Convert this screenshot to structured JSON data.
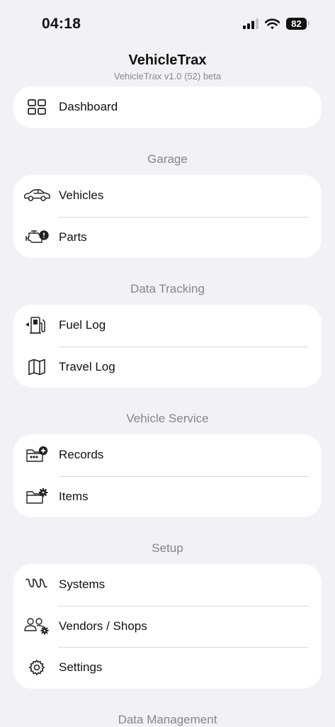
{
  "status_bar": {
    "time": "04:18",
    "battery": "82"
  },
  "header": {
    "title": "VehicleTrax",
    "version": "VehicleTrax v1.0 (52) beta"
  },
  "dashboard": {
    "label": "Dashboard",
    "icon": "grid-icon"
  },
  "sections": {
    "garage": {
      "title": "Garage",
      "items": [
        {
          "label": "Vehicles",
          "icon": "car-icon"
        },
        {
          "label": "Parts",
          "icon": "engine-alert-icon"
        }
      ]
    },
    "data_tracking": {
      "title": "Data Tracking",
      "items": [
        {
          "label": "Fuel Log",
          "icon": "fuel-pump-icon"
        },
        {
          "label": "Travel Log",
          "icon": "map-icon"
        }
      ]
    },
    "vehicle_service": {
      "title": "Vehicle Service",
      "items": [
        {
          "label": "Records",
          "icon": "folder-add-icon"
        },
        {
          "label": "Items",
          "icon": "folder-gear-icon"
        }
      ]
    },
    "setup": {
      "title": "Setup",
      "items": [
        {
          "label": "Systems",
          "icon": "coil-icon"
        },
        {
          "label": "Vendors / Shops",
          "icon": "people-gear-icon"
        },
        {
          "label": "Settings",
          "icon": "gear-icon"
        }
      ]
    },
    "data_management": {
      "title": "Data Management"
    }
  }
}
